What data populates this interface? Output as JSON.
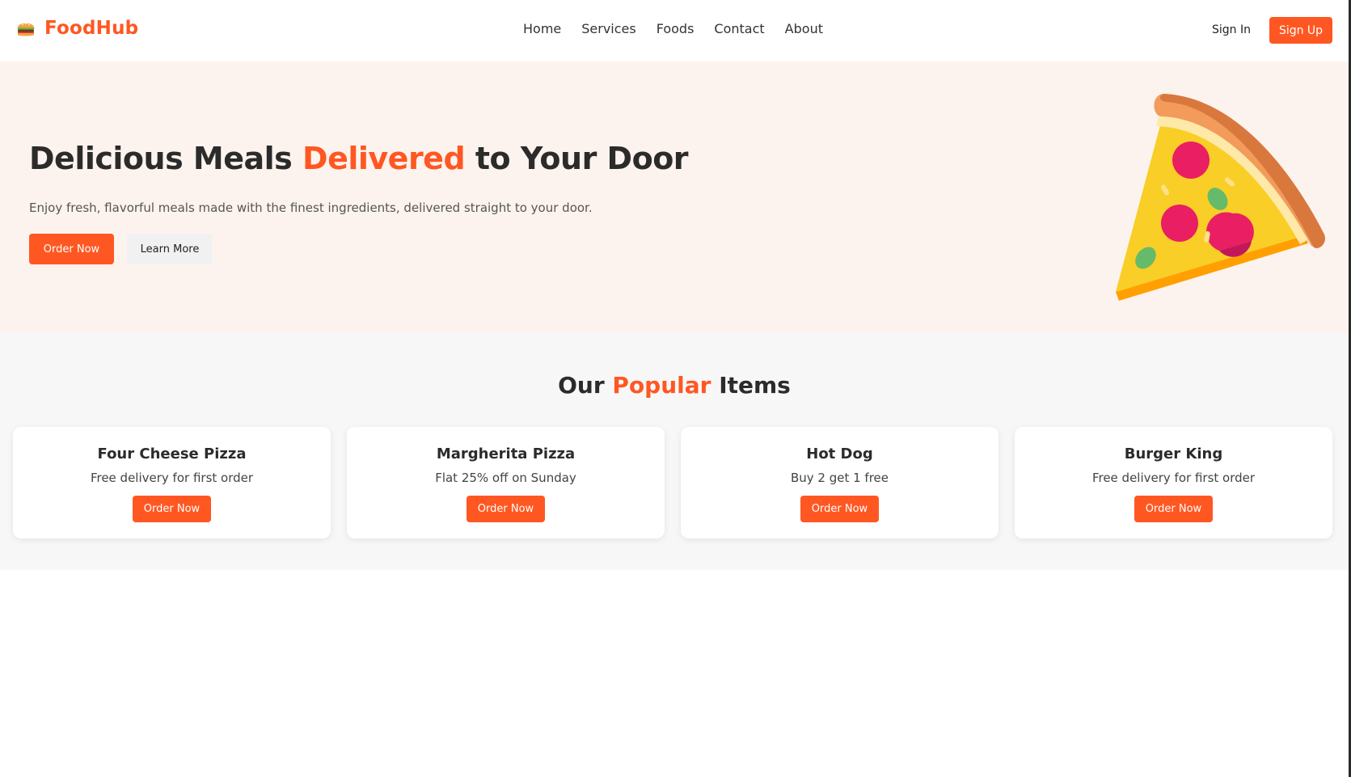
{
  "brand": {
    "name": "FoodHub",
    "icon": "burger-icon"
  },
  "nav": {
    "items": [
      "Home",
      "Services",
      "Foods",
      "Contact",
      "About"
    ]
  },
  "auth": {
    "sign_in": "Sign In",
    "sign_up": "Sign Up"
  },
  "hero": {
    "title_part1": "Delicious Meals ",
    "title_accent": "Delivered",
    "title_part2": " to Your Door",
    "subtitle": "Enjoy fresh, flavorful meals made with the finest ingredients, delivered straight to your door.",
    "primary_button": "Order Now",
    "secondary_button": "Learn More",
    "image_icon": "pizza-slice-icon"
  },
  "popular": {
    "title_part1": "Our ",
    "title_accent": "Popular",
    "title_part2": " Items",
    "items": [
      {
        "name": "Four Cheese Pizza",
        "offer": "Free delivery for first order",
        "button": "Order Now"
      },
      {
        "name": "Margherita Pizza",
        "offer": "Flat 25% off on Sunday",
        "button": "Order Now"
      },
      {
        "name": "Hot Dog",
        "offer": "Buy 2 get 1 free",
        "button": "Order Now"
      },
      {
        "name": "Burger King",
        "offer": "Free delivery for first order",
        "button": "Order Now"
      }
    ]
  },
  "colors": {
    "accent": "#ff5722",
    "hero_bg": "#fdf3ee",
    "section_bg": "#f7f7f7",
    "text_dark": "#2b2b2b"
  }
}
